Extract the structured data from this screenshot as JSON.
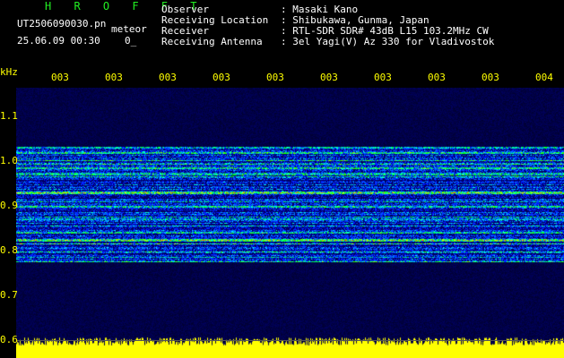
{
  "header": {
    "app_name": "H R O F F T",
    "file_name": "UT2506090030.pn",
    "event_type": "meteor",
    "timestamp": "25.06.09 00:30",
    "count": "0_",
    "info": [
      {
        "label": "Observer",
        "value": ": Masaki Kano"
      },
      {
        "label": "Receiving Location",
        "value": ": Shibukawa, Gunma, Japan"
      },
      {
        "label": "Receiver",
        "value": ": RTL-SDR SDR# 43dB L15 103.2MHz CW"
      },
      {
        "label": "Receiving Antenna",
        "value": ": 3el Yagi(V) Az 330 for Vladivostok"
      }
    ]
  },
  "plot": {
    "y_unit": "kHz",
    "y_ticks": [
      "1.1",
      "1.0",
      "0.9",
      "0.8",
      "0.7",
      "0.6"
    ],
    "x_ticks": [
      "003",
      "003",
      "003",
      "003",
      "003",
      "003",
      "003",
      "003",
      "003",
      "004"
    ],
    "colors": {
      "background": "#000000",
      "label": "#ffff00",
      "title": "#22ee22",
      "spectrum": "#ffff00"
    },
    "strong_bands_khz": [
      0.934,
      0.829
    ],
    "band_edges_khz": [
      1.036,
      0.779
    ]
  }
}
